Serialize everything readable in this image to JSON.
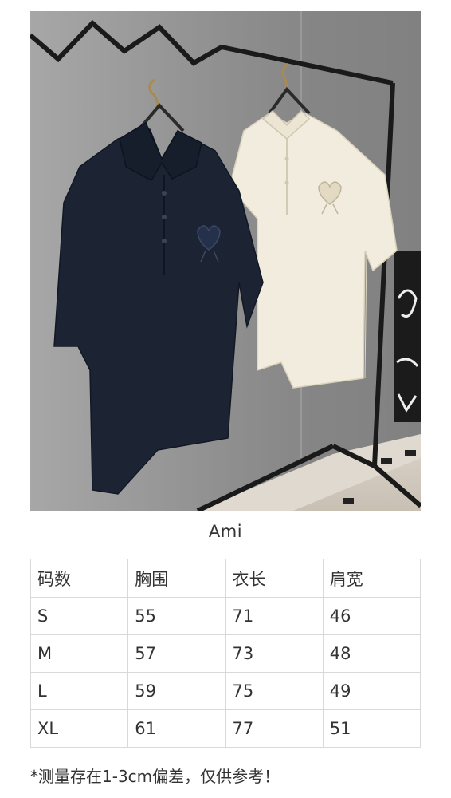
{
  "product": {
    "brand": "Ami",
    "photo_alt": "Two Ami polo shirts on a hanger rack",
    "colors": {
      "navy": "#1c2434",
      "cream": "#f1ecdd"
    }
  },
  "size_table": {
    "headers": [
      "码数",
      "胸围",
      "衣长",
      "肩宽"
    ],
    "rows": [
      [
        "S",
        "55",
        "71",
        "46"
      ],
      [
        "M",
        "57",
        "73",
        "48"
      ],
      [
        "L",
        "59",
        "75",
        "49"
      ],
      [
        "XL",
        "61",
        "77",
        "51"
      ]
    ]
  },
  "note": "*测量存在1-3cm偏差，仅供参考！"
}
